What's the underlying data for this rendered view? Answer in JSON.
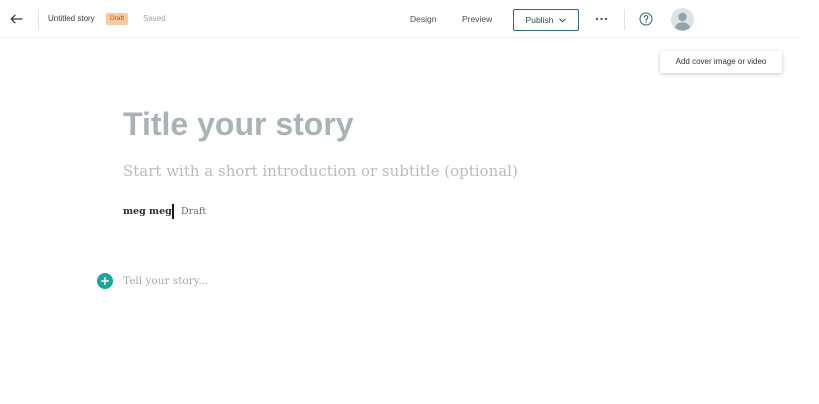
{
  "header": {
    "back_icon": "arrow-left-icon",
    "story_title": "Untitled story",
    "status_badge": "Draft",
    "save_status": "Saved",
    "nav": {
      "design": "Design",
      "preview": "Preview"
    },
    "publish_label": "Publish",
    "publish_icon": "chevron-down-icon",
    "more_icon": "ellipsis-icon",
    "help_icon": "question-circle-icon",
    "avatar_icon": "user-avatar-icon"
  },
  "cover": {
    "label": "Add cover image or video"
  },
  "editor": {
    "title_placeholder": "Title your story",
    "subtitle_placeholder": "Start with a short introduction or subtitle (optional)",
    "author": "meg meg",
    "byline_status": "Draft",
    "add_icon": "plus-circle-icon",
    "body_placeholder": "Tell your story..."
  },
  "colors": {
    "accent_teal": "#18a59b",
    "publish_border": "#2e6d7d",
    "draft_badge_bg": "#f9c9a0",
    "draft_badge_text": "#b85a1a",
    "title_placeholder": "#a9b2b5"
  }
}
